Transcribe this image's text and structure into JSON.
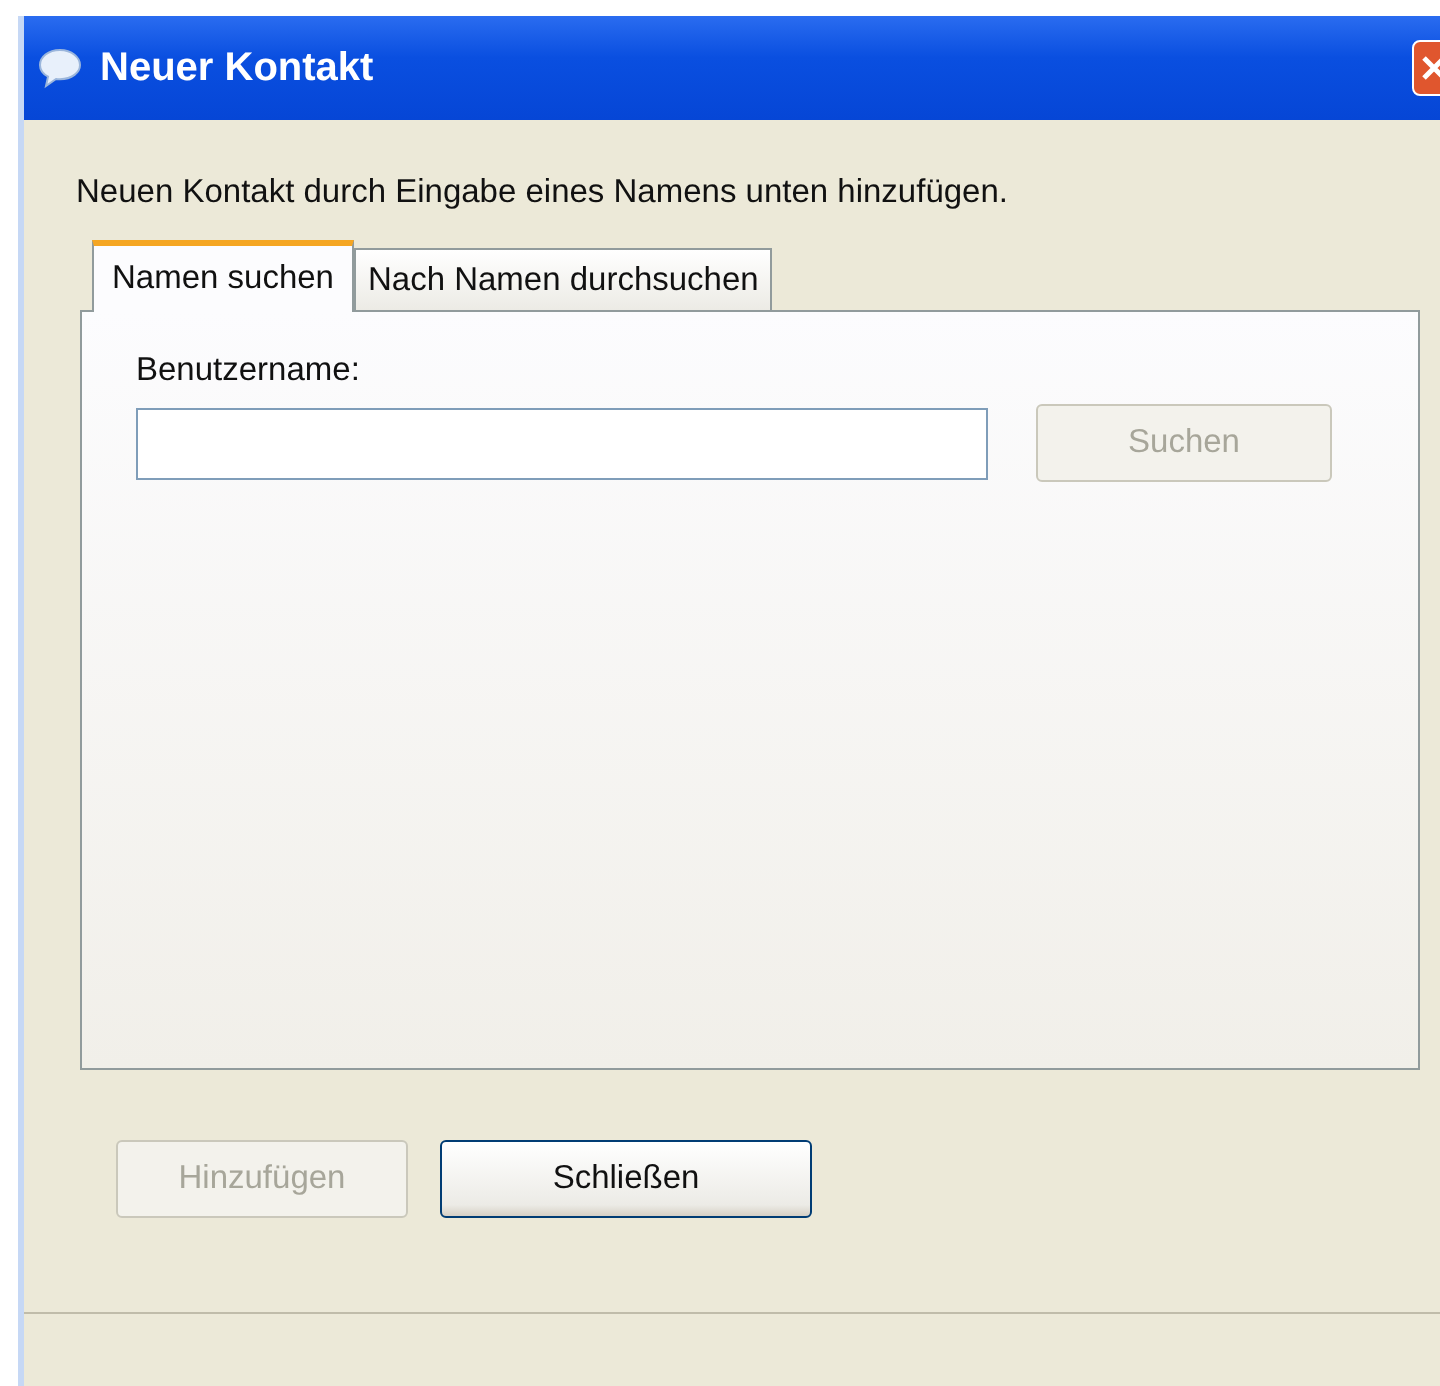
{
  "window": {
    "title": "Neuer Kontakt"
  },
  "instruction": "Neuen Kontakt durch Eingabe eines Namens unten hinzufügen.",
  "tabs": [
    {
      "label": "Namen suchen",
      "selected": true
    },
    {
      "label": "Nach Namen durchsuchen",
      "selected": false
    }
  ],
  "username_field": {
    "label": "Benutzername:"
  },
  "search_button": {
    "label": "Suchen",
    "disabled": true
  },
  "buttons": [
    {
      "label": "Hinzufügen",
      "disabled": true
    },
    {
      "label": "Schließen",
      "disabled": false
    }
  ]
}
